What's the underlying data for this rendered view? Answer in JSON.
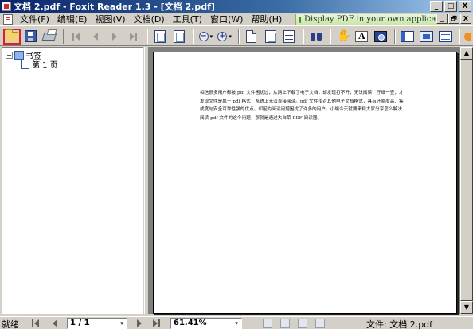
{
  "window": {
    "title": "文档 2.pdf - Foxit Reader 1.3 - [文档 2.pdf]",
    "controls": [
      "_",
      "□",
      "X"
    ],
    "mdi_controls": [
      "_",
      "🗗",
      "X"
    ]
  },
  "menu": {
    "items": [
      "文件(F)",
      "编辑(E)",
      "视图(V)",
      "文档(D)",
      "工具(T)",
      "窗口(W)",
      "帮助(H)"
    ],
    "banner": "Display PDF in your own applications"
  },
  "toolbar": {
    "buttons": [
      {
        "name": "open-icon",
        "active": true
      },
      {
        "name": "save-icon"
      },
      {
        "name": "print-icon"
      },
      {
        "name": "first-page-icon",
        "enabled": false
      },
      {
        "name": "prev-page-icon",
        "enabled": false
      },
      {
        "name": "next-page-icon",
        "enabled": false
      },
      {
        "name": "last-page-icon",
        "enabled": false
      },
      {
        "name": "rotate-icon"
      },
      {
        "name": "zoom-out-icon"
      },
      {
        "name": "zoom-in-icon"
      },
      {
        "name": "actual-size-icon"
      },
      {
        "name": "fit-page-icon"
      },
      {
        "name": "fit-width-icon"
      },
      {
        "name": "find-icon"
      },
      {
        "name": "hand-tool-icon"
      },
      {
        "name": "text-select-icon"
      },
      {
        "name": "snapshot-icon"
      },
      {
        "name": "bookmark-panel-icon"
      },
      {
        "name": "fullscreen-icon"
      },
      {
        "name": "properties-icon"
      }
    ],
    "zoom_out_glyph": "−",
    "zoom_in_glyph": "+",
    "text_tool_glyph": "A",
    "dropdown_glyph": "▾"
  },
  "bookmarks": {
    "root_label": "书签",
    "child_label": "第 1 页",
    "expander": "−"
  },
  "document": {
    "body": "相信很多用户都被 pdf 文件困扰过，从网上下载了电子文档，却发现打不开，无法阅读，仔细一查，才发现文件是属于 pdf 格式，系统上无法直接阅读。pdf 文件相对其他电子文档格式，具有还原度高、集成度与安全可靠性强的优点，却因为阅读问题困扰了许多的用户。小编今天就要来和大家分享怎么解决阅读 pdf 文件的这个问题，那就是通过大白菜 PDF 阅读器。"
  },
  "status": {
    "ready": "就绪",
    "page": "1 / 1",
    "zoom": "61.41%",
    "file": "文件: 文档 2.pdf"
  },
  "scroll": {
    "up": "▲",
    "down": "▼"
  }
}
